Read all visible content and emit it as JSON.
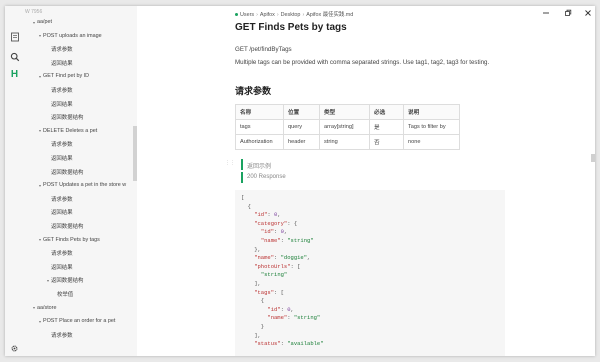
{
  "sidebar": {
    "top_label": "W 7956",
    "items": [
      {
        "label": "aa/pet",
        "level": 0,
        "arrow": "▾"
      },
      {
        "label": "POST uploads an image",
        "level": 1,
        "arrow": "▾"
      },
      {
        "label": "请求参数",
        "level": 2,
        "arrow": ""
      },
      {
        "label": "返回结果",
        "level": 2,
        "arrow": ""
      },
      {
        "label": "GET Find pet by ID",
        "level": 1,
        "arrow": "▾"
      },
      {
        "label": "请求参数",
        "level": 2,
        "arrow": ""
      },
      {
        "label": "返回结果",
        "level": 2,
        "arrow": ""
      },
      {
        "label": "返回数据结构",
        "level": 2,
        "arrow": ""
      },
      {
        "label": "DELETE Deletes a pet",
        "level": 1,
        "arrow": "▾"
      },
      {
        "label": "请求参数",
        "level": 2,
        "arrow": ""
      },
      {
        "label": "返回结果",
        "level": 2,
        "arrow": ""
      },
      {
        "label": "返回数据结构",
        "level": 2,
        "arrow": ""
      },
      {
        "label": "POST Updates a pet in the store w",
        "level": 1,
        "arrow": "▾"
      },
      {
        "label": "请求参数",
        "level": 2,
        "arrow": ""
      },
      {
        "label": "返回结果",
        "level": 2,
        "arrow": ""
      },
      {
        "label": "返回数据结构",
        "level": 2,
        "arrow": ""
      },
      {
        "label": "GET Finds Pets by tags",
        "level": 1,
        "arrow": "▾"
      },
      {
        "label": "请求参数",
        "level": 2,
        "arrow": ""
      },
      {
        "label": "返回结果",
        "level": 2,
        "arrow": ""
      },
      {
        "label": "返回数据结构",
        "level": 2,
        "arrow": "▾"
      },
      {
        "label": "枚举值",
        "level": 3,
        "arrow": ""
      },
      {
        "label": "aa/store",
        "level": 0,
        "arrow": "▾"
      },
      {
        "label": "POST Place an order for a pet",
        "level": 1,
        "arrow": "▾"
      },
      {
        "label": "请求参数",
        "level": 2,
        "arrow": ""
      }
    ]
  },
  "breadcrumb": {
    "parts": [
      "Users",
      "Apifox",
      "Desktop",
      "Apifox 最佳实践.md"
    ]
  },
  "doc": {
    "title": "GET Finds Pets by tags",
    "endpoint": "GET /pet/findByTags",
    "description": "Multiple tags can be provided with comma separated strings. Use tag1, tag2, tag3 for testing.",
    "params_heading": "请求参数",
    "table_headers": [
      "名称",
      "位置",
      "类型",
      "必选",
      "说明"
    ],
    "table_rows": [
      [
        "tags",
        "query",
        "array[string]",
        "是",
        "Tags to filter by"
      ],
      [
        "Authorization",
        "header",
        "string",
        "否",
        "none"
      ]
    ],
    "quote_1": "返回示例",
    "quote_2": "200 Response",
    "code_lines": [
      "[",
      "  {",
      "    \"id\": 0,",
      "    \"category\": {",
      "      \"id\": 0,",
      "      \"name\": \"string\"",
      "    },",
      "    \"name\": \"doggie\",",
      "    \"photoUrls\": [",
      "      \"string\"",
      "    ],",
      "    \"tags\": [",
      "      {",
      "        \"id\": 0,",
      "        \"name\": \"string\"",
      "      }",
      "    ],",
      "    \"status\": \"available\""
    ]
  },
  "colors": {
    "accent": "#1aa260",
    "sidebar_bg": "#f6f6f6"
  },
  "icons": {
    "activity": [
      "files-icon",
      "search-icon",
      "outline-icon",
      "gear-icon"
    ],
    "window": [
      "minimize-icon",
      "restore-icon",
      "close-icon"
    ]
  }
}
